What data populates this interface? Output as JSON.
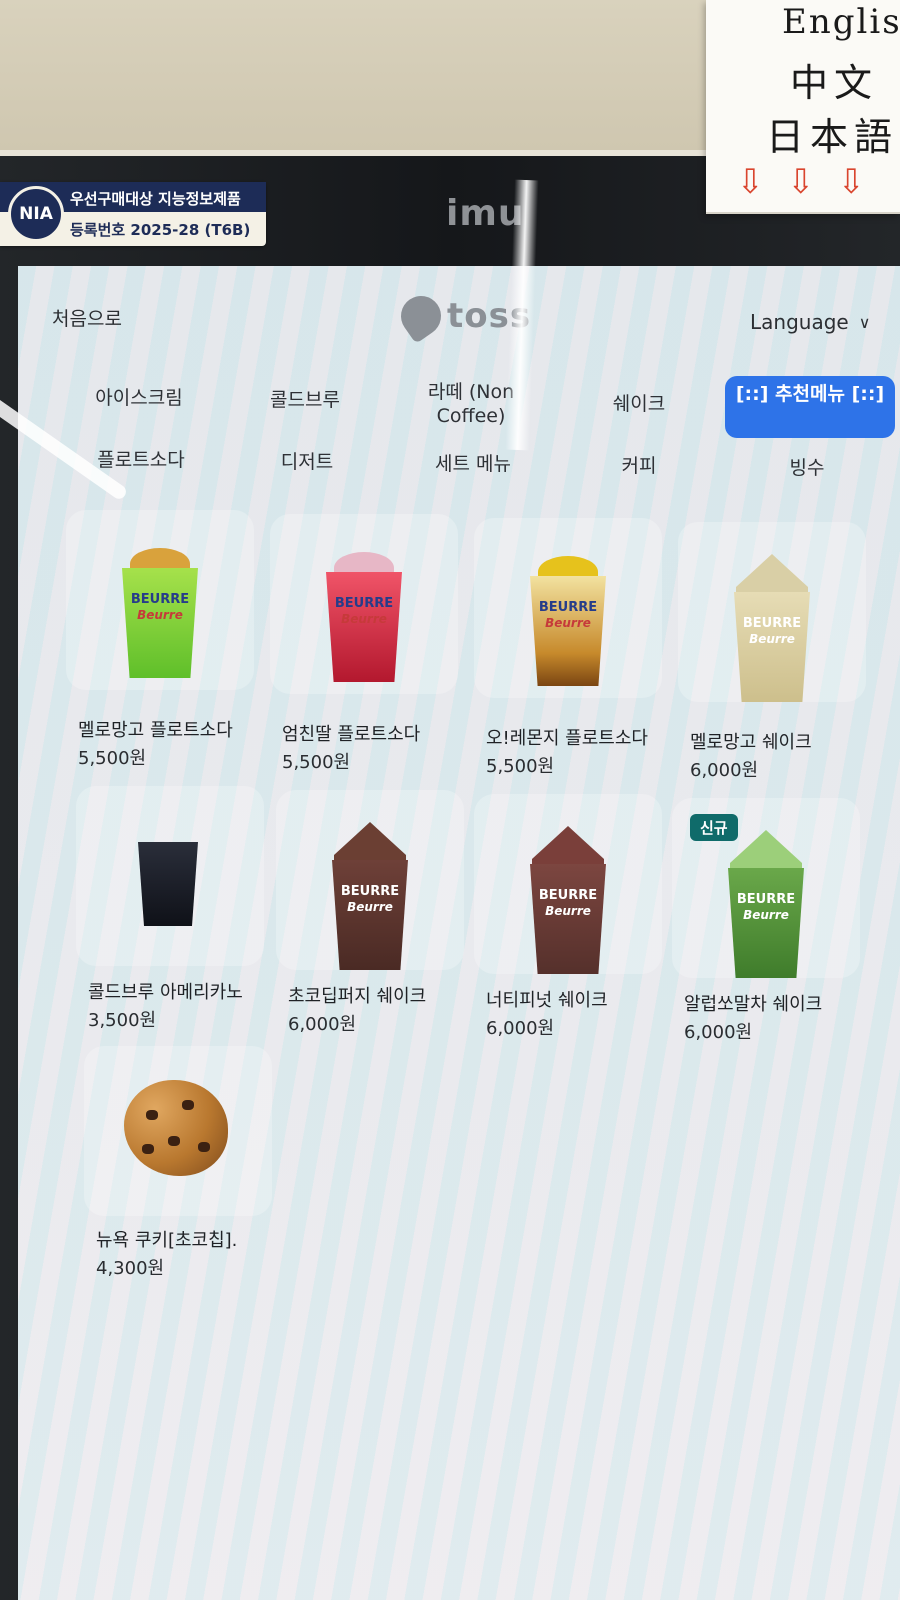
{
  "sticky_note": {
    "line1": "English",
    "line2": "中文",
    "line3": "日本語",
    "arrows": "⇩⇩⇩"
  },
  "badge": {
    "seal": "NIA",
    "line1": "우선구매대상 지능정보제품",
    "line2": "등록번호 2025-28 (T6B)"
  },
  "kiosk_brand": "imu",
  "header": {
    "home_label": "처음으로",
    "logo_text": "toss",
    "language_label": "Language",
    "language_chevron": "∨"
  },
  "categories": [
    {
      "label": "아이스크림"
    },
    {
      "label": "콜드브루"
    },
    {
      "label": "라떼 (Non Coffee)"
    },
    {
      "label": "쉐이크"
    },
    {
      "label": "[::] 추천메뉴 [::]",
      "active": true
    },
    {
      "label": "플로트소다"
    },
    {
      "label": "디저트"
    },
    {
      "label": "세트 메뉴"
    },
    {
      "label": "커피"
    },
    {
      "label": "빙수"
    }
  ],
  "products": [
    {
      "name": "멜로망고 플로트소다",
      "price": "5,500원"
    },
    {
      "name": "엄친딸 플로트소다",
      "price": "5,500원"
    },
    {
      "name": "오!레몬지 플로트소다",
      "price": "5,500원"
    },
    {
      "name": "멜로망고 쉐이크",
      "price": "6,000원"
    },
    {
      "name": "콜드브루 아메리카노",
      "price": "3,500원"
    },
    {
      "name": "초코딥퍼지 쉐이크",
      "price": "6,000원"
    },
    {
      "name": "너티피넛 쉐이크",
      "price": "6,000원"
    },
    {
      "name": "알럽쏘말차 쉐이크",
      "price": "6,000원",
      "badge": "신규"
    },
    {
      "name": "뉴욕 쿠키[초코칩].",
      "price": "4,300원"
    }
  ],
  "cup_logo": {
    "top": "BEURRE",
    "bottom": "Beurre"
  },
  "colors": {
    "active_category_bg": "#2e73e8",
    "new_badge_bg": "#0f6b6a",
    "screen_bg": "#e6eef0"
  }
}
